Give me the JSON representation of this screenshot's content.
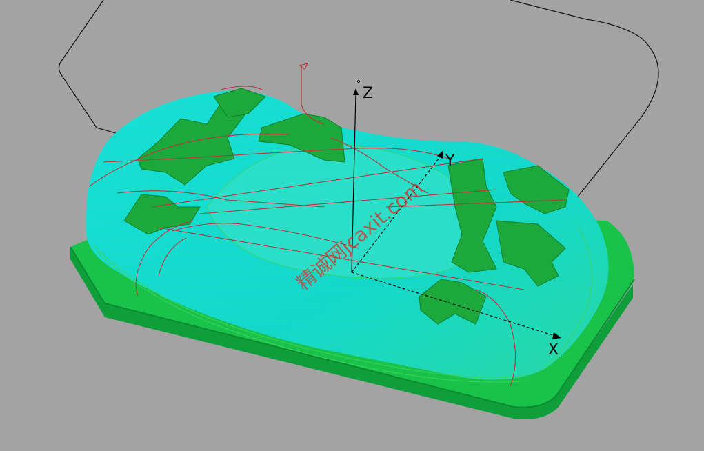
{
  "viewport": {
    "background": "#a4a3a4",
    "axes": {
      "x": "X",
      "y": "Y",
      "z": "Z"
    },
    "watermark": "精诚网jcaxit.com"
  },
  "colors": {
    "base_top": "#19c34a",
    "base_side": "#0e9f3b",
    "surface": "#15dcd2",
    "pocket": "#1da83c",
    "toolpath": "#c0303a",
    "contour": "#3cd35e",
    "outline": "#1a1a1a"
  }
}
